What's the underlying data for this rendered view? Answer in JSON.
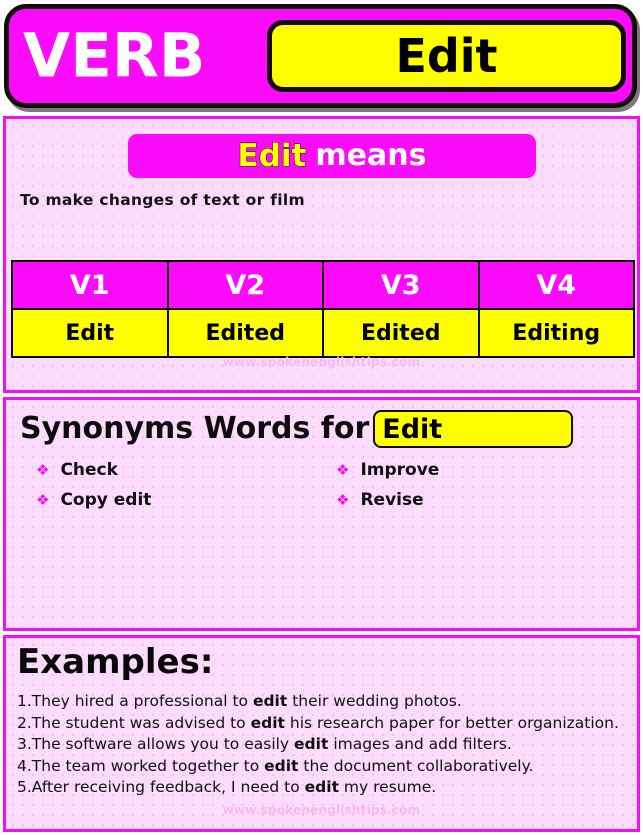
{
  "header": {
    "part_of_speech": "VERB",
    "word": "Edit",
    "accent_magenta": "#fa0bfa",
    "accent_yellow": "#ffff00",
    "border_black": "#15090f"
  },
  "meaning": {
    "badge_word": "Edit",
    "badge_suffix": "means",
    "definition": "To make changes of text or film"
  },
  "forms_table": {
    "headers": [
      "V1",
      "V2",
      "V3",
      "V4"
    ],
    "values": [
      "Edit",
      "Edited",
      "Edited",
      "Editing"
    ]
  },
  "synonyms": {
    "title": "Synonyms Words for",
    "word": "Edit",
    "bullet_glyph": "❖",
    "column_1": [
      "Check",
      "Copy edit"
    ],
    "column_2": [
      "Improve",
      "Revise"
    ]
  },
  "examples": {
    "title": "Examples:",
    "items": [
      {
        "number": "1.",
        "before": "They hired a professional to ",
        "bold": "edit",
        "after": " their wedding photos."
      },
      {
        "number": "2.",
        "before": "The student was advised to ",
        "bold": "edit",
        "after": " his research paper for better organization."
      },
      {
        "number": "3.",
        "before": "The software allows you to easily ",
        "bold": "edit",
        "after": " images and add filters."
      },
      {
        "number": "4.",
        "before": "The team worked together to ",
        "bold": "edit",
        "after": " the document collaboratively."
      },
      {
        "number": "5.",
        "before": "After receiving feedback, I need to ",
        "bold": "edit",
        "after": " my resume."
      }
    ]
  },
  "watermark": "www.spokenenglishtips.com"
}
